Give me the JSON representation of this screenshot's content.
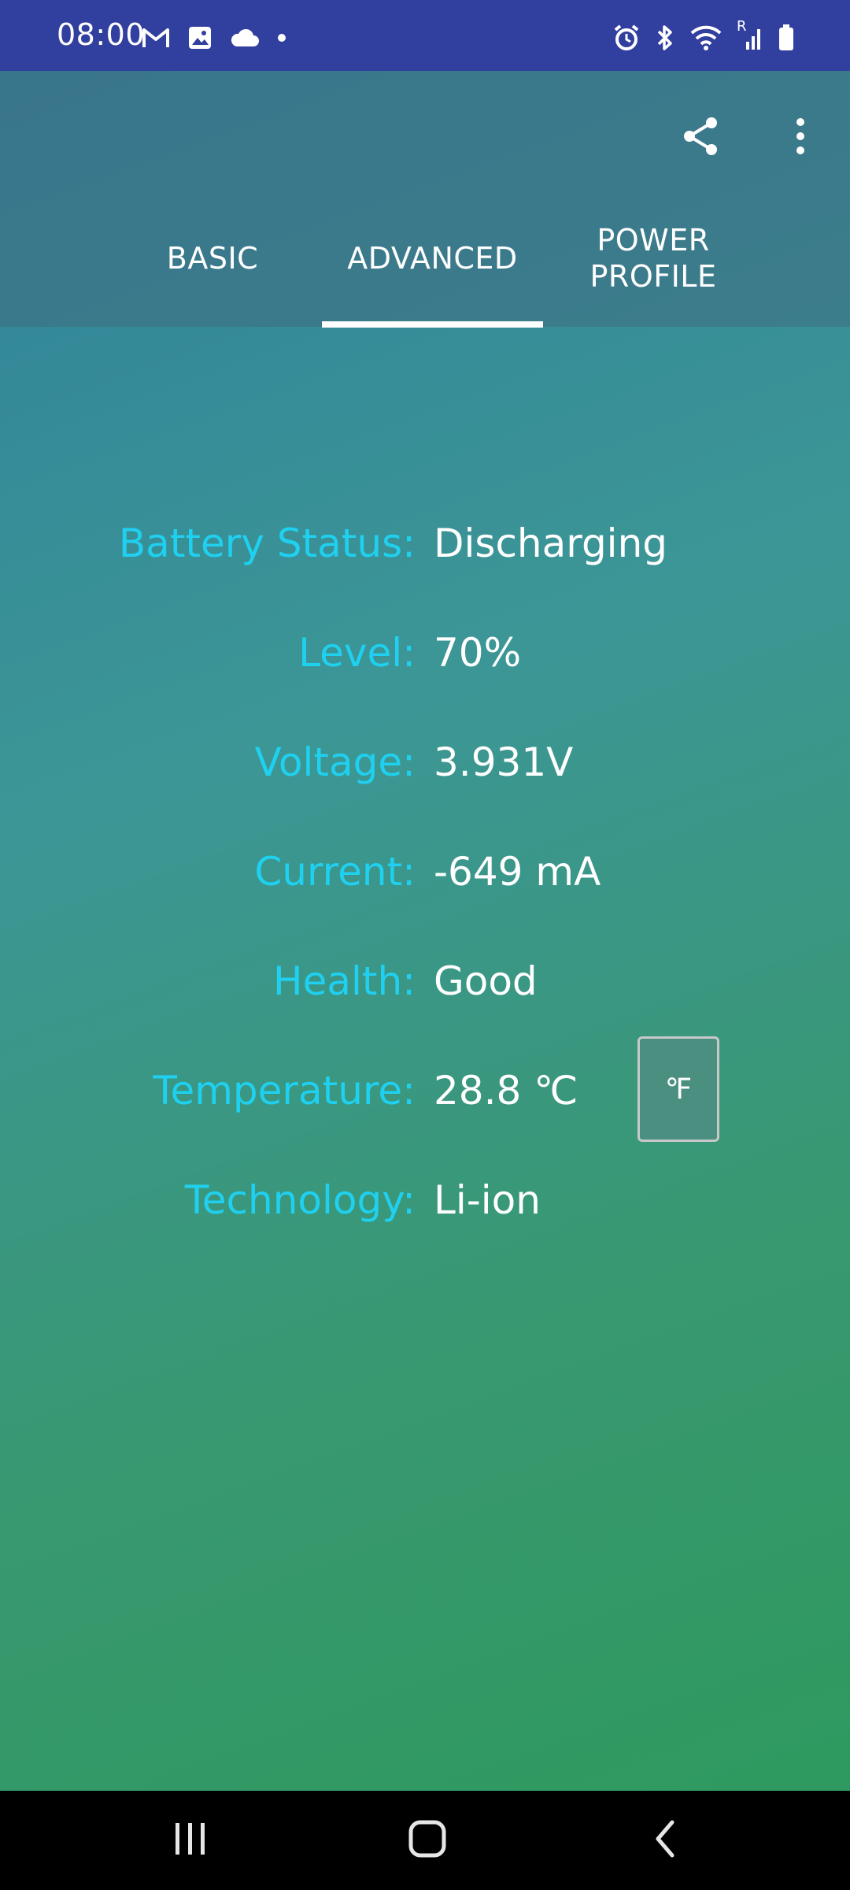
{
  "status_bar": {
    "time": "08:00",
    "left_icons": [
      "gmail-icon",
      "gallery-icon",
      "cloud-icon",
      "dot-icon"
    ],
    "right_icons": [
      "alarm-icon",
      "bluetooth-icon",
      "wifi-icon",
      "signal-icon",
      "battery-icon"
    ],
    "signal_label": "R"
  },
  "app_bar": {
    "actions": [
      "share-icon",
      "more-vert-icon"
    ]
  },
  "tabs": {
    "basic": "BASIC",
    "advanced": "ADVANCED",
    "power_line1": "POWER",
    "power_line2": "PROFILE",
    "selected": "ADVANCED"
  },
  "battery": {
    "status_label": "Battery Status:",
    "status_value": "Discharging",
    "level_label": "Level:",
    "level_value": "70%",
    "voltage_label": "Voltage:",
    "voltage_value": "3.931V",
    "current_label": "Current:",
    "current_value": "-649 mA",
    "health_label": "Health:",
    "health_value": "Good",
    "temperature_label": "Temperature:",
    "temperature_value": "28.8 ℃",
    "technology_label": "Technology:",
    "technology_value": "Li-ion"
  },
  "unit_toggle": {
    "label": "℉"
  },
  "nav_bar": {
    "buttons": [
      "recents-icon",
      "home-icon",
      "back-icon"
    ]
  },
  "colors": {
    "status_bar": "#313f9e",
    "label": "#1fd0f0",
    "value": "#ffffff",
    "nav_bar": "#000000"
  }
}
